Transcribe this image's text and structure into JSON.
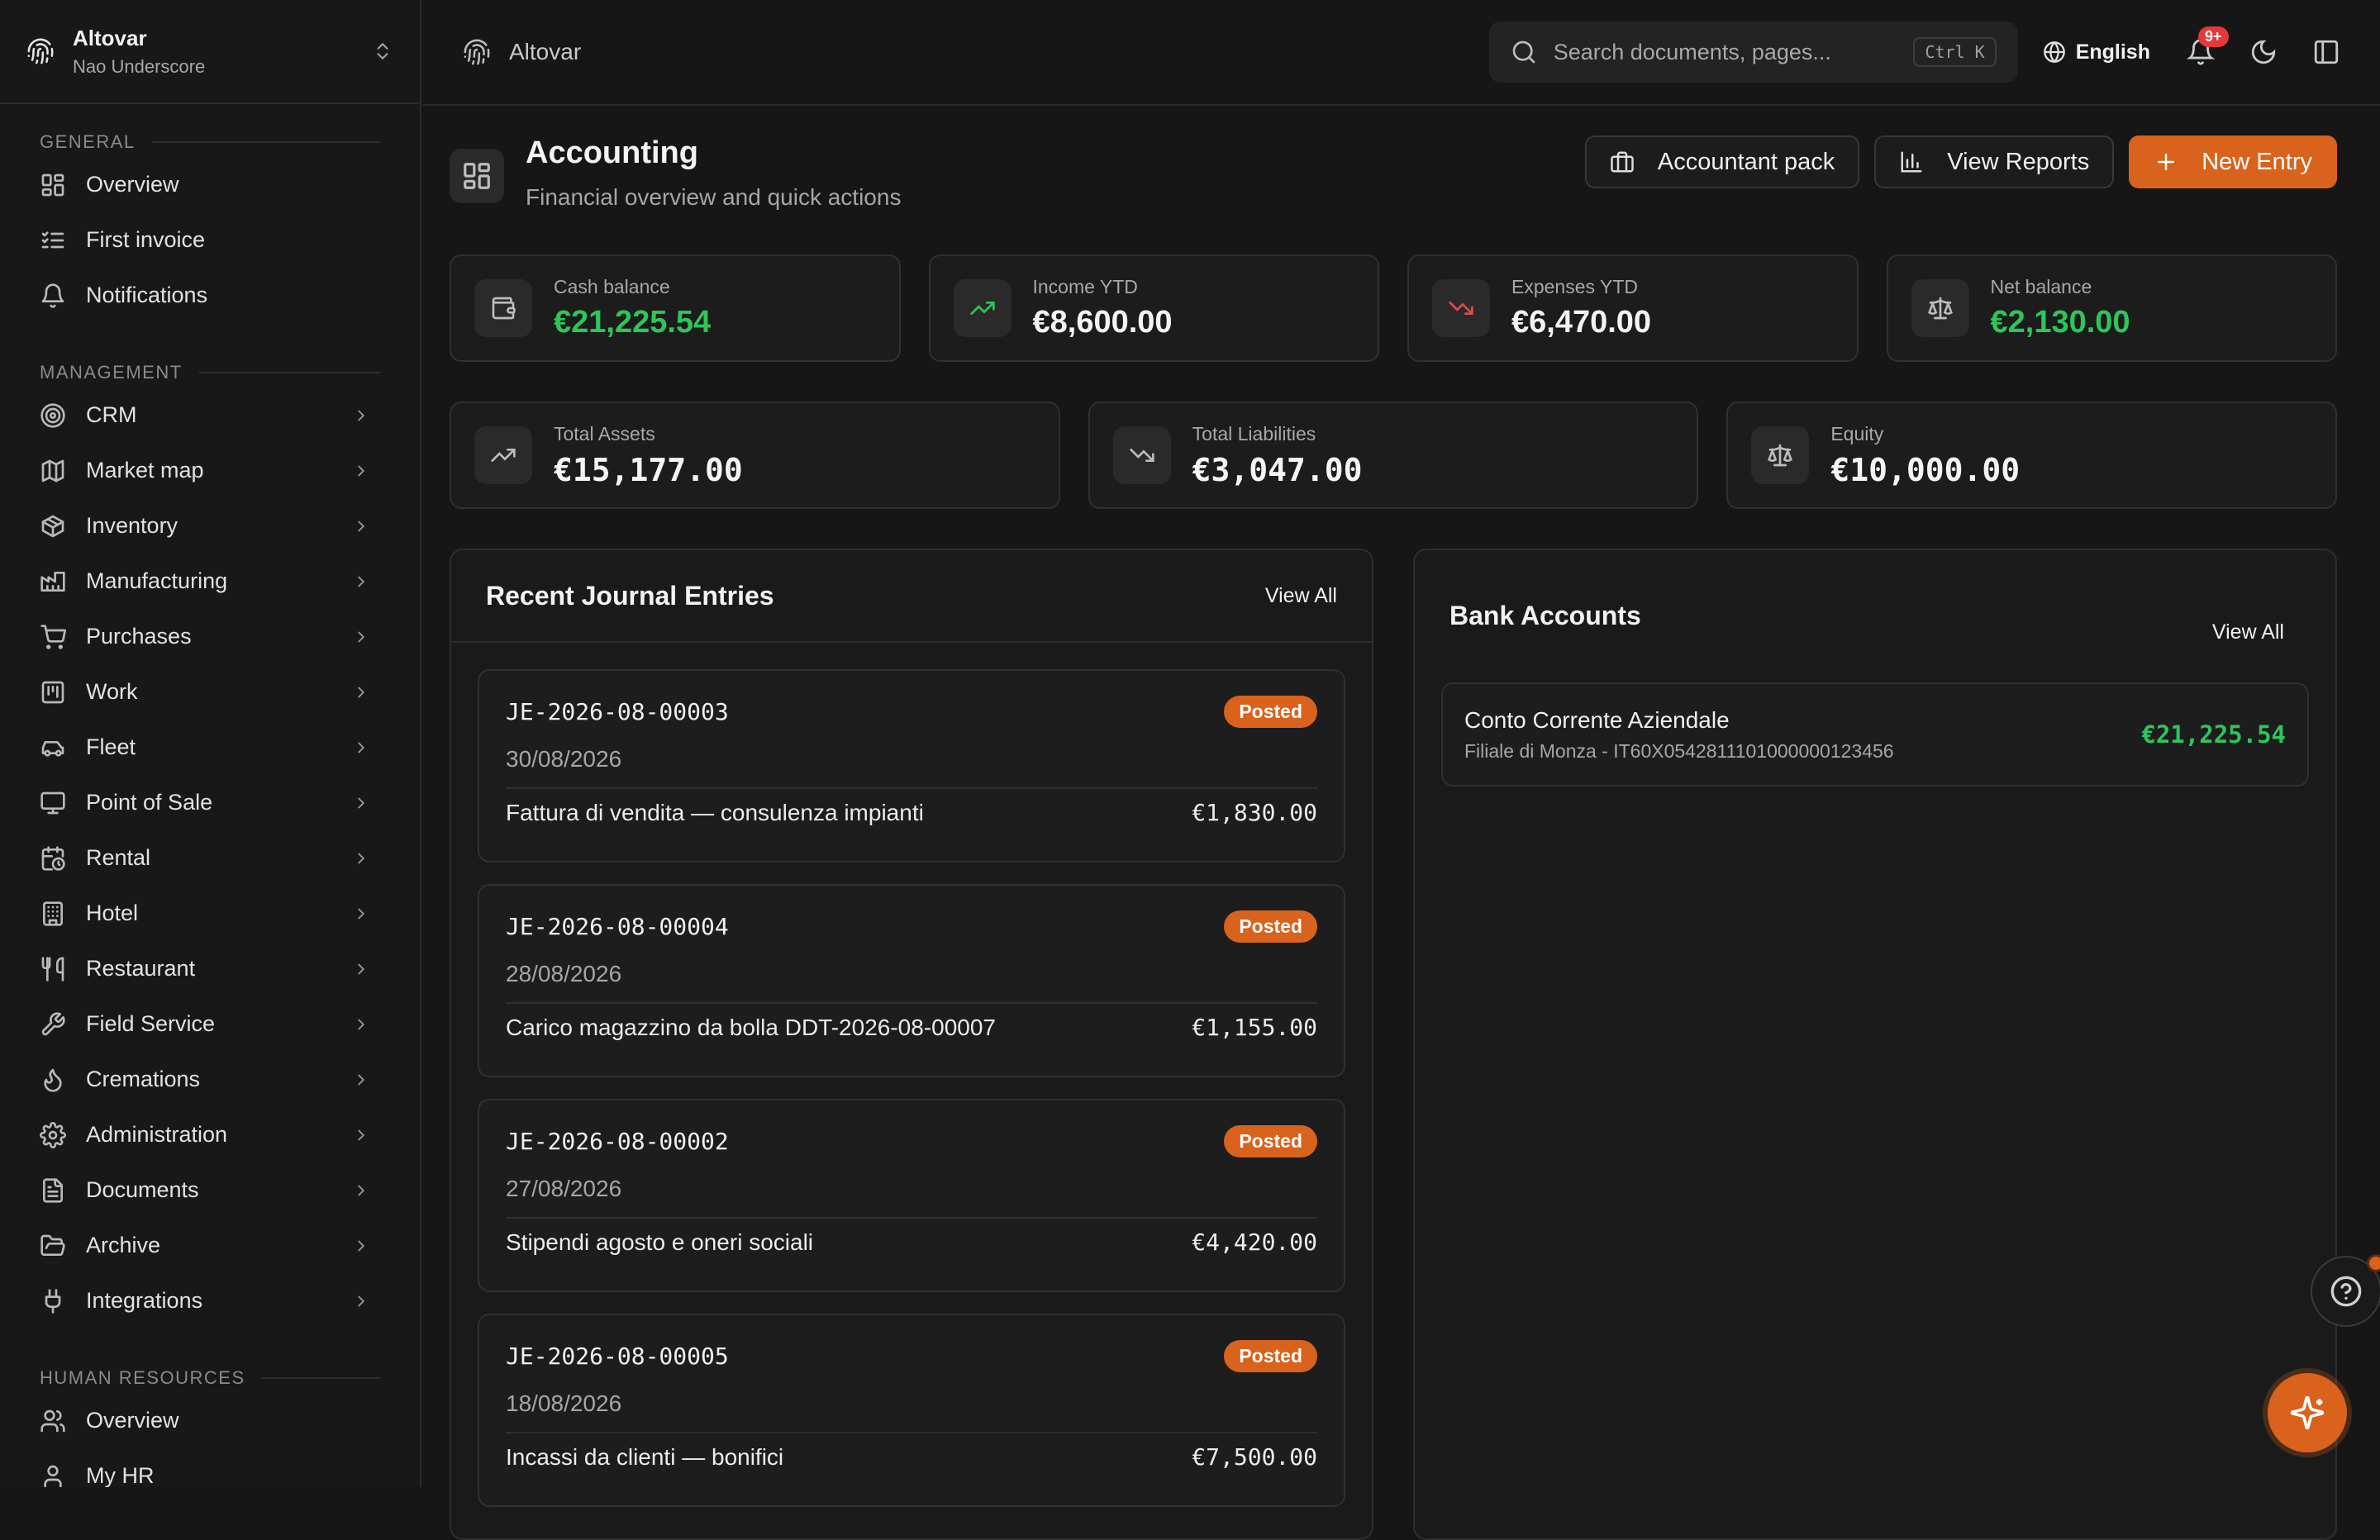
{
  "workspace": {
    "name": "Altovar",
    "user": "Nao Underscore"
  },
  "sidebar": {
    "sections": [
      {
        "label": "GENERAL",
        "items": [
          {
            "label": "Overview",
            "icon": "dashboard-icon",
            "chevron": false
          },
          {
            "label": "First invoice",
            "icon": "checklist-icon",
            "chevron": false
          },
          {
            "label": "Notifications",
            "icon": "bell-icon",
            "chevron": false
          }
        ]
      },
      {
        "label": "MANAGEMENT",
        "items": [
          {
            "label": "CRM",
            "icon": "target-icon",
            "chevron": true
          },
          {
            "label": "Market map",
            "icon": "map-icon",
            "chevron": true
          },
          {
            "label": "Inventory",
            "icon": "package-icon",
            "chevron": true
          },
          {
            "label": "Manufacturing",
            "icon": "factory-icon",
            "chevron": true
          },
          {
            "label": "Purchases",
            "icon": "cart-icon",
            "chevron": true
          },
          {
            "label": "Work",
            "icon": "kanban-icon",
            "chevron": true
          },
          {
            "label": "Fleet",
            "icon": "car-icon",
            "chevron": true
          },
          {
            "label": "Point of Sale",
            "icon": "monitor-icon",
            "chevron": true
          },
          {
            "label": "Rental",
            "icon": "calendar-clock-icon",
            "chevron": true
          },
          {
            "label": "Hotel",
            "icon": "building-icon",
            "chevron": true
          },
          {
            "label": "Restaurant",
            "icon": "utensils-icon",
            "chevron": true
          },
          {
            "label": "Field Service",
            "icon": "wrench-icon",
            "chevron": true
          },
          {
            "label": "Cremations",
            "icon": "flame-icon",
            "chevron": true
          },
          {
            "label": "Administration",
            "icon": "gear-icon",
            "chevron": true
          },
          {
            "label": "Documents",
            "icon": "file-icon",
            "chevron": true
          },
          {
            "label": "Archive",
            "icon": "folder-open-icon",
            "chevron": true
          },
          {
            "label": "Integrations",
            "icon": "plug-icon",
            "chevron": true
          }
        ]
      },
      {
        "label": "HUMAN RESOURCES",
        "items": [
          {
            "label": "Overview",
            "icon": "users-icon",
            "chevron": false
          },
          {
            "label": "My HR",
            "icon": "user-icon",
            "chevron": false
          }
        ]
      }
    ]
  },
  "topbar": {
    "brand": "Altovar",
    "search_placeholder": "Search documents, pages...",
    "search_shortcut": "Ctrl K",
    "language": "English",
    "notification_badge": "9+"
  },
  "page": {
    "title": "Accounting",
    "subtitle": "Financial overview and quick actions",
    "actions": {
      "accountant_pack": "Accountant pack",
      "view_reports": "View Reports",
      "new_entry": "New Entry"
    }
  },
  "stats_row1": [
    {
      "label": "Cash balance",
      "value": "€21,225.54",
      "icon": "wallet-icon",
      "accent": "#2ec55a"
    },
    {
      "label": "Income YTD",
      "value": "€8,600.00",
      "icon": "trending-up-icon",
      "accent": "#2ec55a"
    },
    {
      "label": "Expenses YTD",
      "value": "€6,470.00",
      "icon": "trending-down-icon",
      "accent": "#e5484d"
    },
    {
      "label": "Net balance",
      "value": "€2,130.00",
      "icon": "scale-icon",
      "accent": "#2ec55a"
    }
  ],
  "stats_row2": [
    {
      "label": "Total Assets",
      "value": "€15,177.00",
      "icon": "trending-up-icon"
    },
    {
      "label": "Total Liabilities",
      "value": "€3,047.00",
      "icon": "trending-down-icon"
    },
    {
      "label": "Equity",
      "value": "€10,000.00",
      "icon": "scale-icon"
    }
  ],
  "journal": {
    "title": "Recent Journal Entries",
    "view_all": "View All",
    "entries": [
      {
        "id": "JE-2026-08-00003",
        "status": "Posted",
        "date": "30/08/2026",
        "description": "Fattura di vendita — consulenza impianti",
        "amount": "€1,830.00"
      },
      {
        "id": "JE-2026-08-00004",
        "status": "Posted",
        "date": "28/08/2026",
        "description": "Carico magazzino da bolla DDT-2026-08-00007",
        "amount": "€1,155.00"
      },
      {
        "id": "JE-2026-08-00002",
        "status": "Posted",
        "date": "27/08/2026",
        "description": "Stipendi agosto e oneri sociali",
        "amount": "€4,420.00"
      },
      {
        "id": "JE-2026-08-00005",
        "status": "Posted",
        "date": "18/08/2026",
        "description": "Incassi da clienti — bonifici",
        "amount": "€7,500.00"
      }
    ]
  },
  "bank": {
    "title": "Bank Accounts",
    "view_all": "View All",
    "accounts": [
      {
        "name": "Conto Corrente Aziendale",
        "detail": "Filiale di Monza - IT60X0542811101000000123456",
        "balance": "€21,225.54"
      }
    ]
  },
  "colors": {
    "accent": "#d9621c",
    "positive": "#2ec55a",
    "negative": "#e5484d",
    "background": "#161616"
  }
}
